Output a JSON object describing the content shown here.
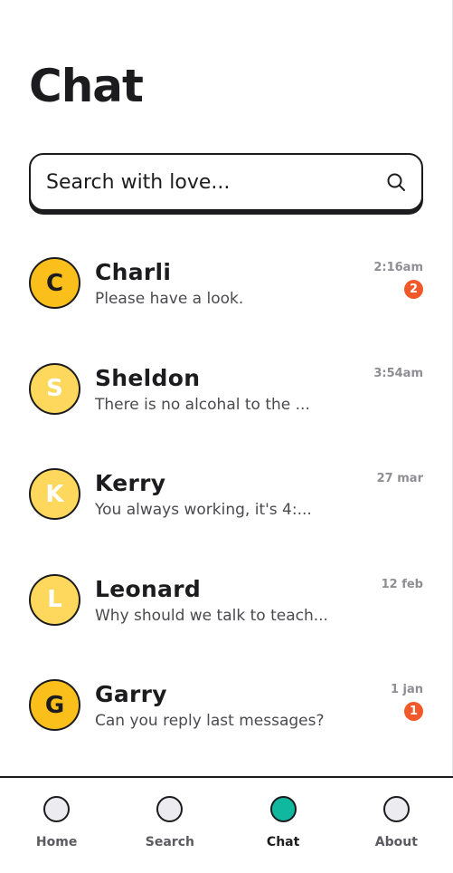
{
  "header": {
    "title": "Chat"
  },
  "search": {
    "placeholder": "Search with love..."
  },
  "chats": [
    {
      "initial": "C",
      "name": "Charli",
      "preview": "Please have a look.",
      "time": "2:16am",
      "unread": "2"
    },
    {
      "initial": "S",
      "name": "Sheldon",
      "preview": "There is no alcohal to the ...",
      "time": "3:54am",
      "unread": ""
    },
    {
      "initial": "K",
      "name": "Kerry",
      "preview": "You always working, it's 4:...",
      "time": "27 mar",
      "unread": ""
    },
    {
      "initial": "L",
      "name": "Leonard",
      "preview": "Why should we talk to teach...",
      "time": "12 feb",
      "unread": ""
    },
    {
      "initial": "G",
      "name": "Garry",
      "preview": "Can you reply last messages?",
      "time": "1 jan",
      "unread": "1"
    }
  ],
  "tabs": [
    {
      "label": "Home"
    },
    {
      "label": "Search"
    },
    {
      "label": "Chat"
    },
    {
      "label": "About"
    }
  ],
  "colors": {
    "accent_active_tab": "#10b8a0",
    "unread_badge": "#f2592a",
    "avatar_active": "#fbbf1c",
    "avatar": "#fdd85d",
    "text_dark": "#1c1c1e"
  },
  "icons": {
    "search": "search-icon"
  }
}
